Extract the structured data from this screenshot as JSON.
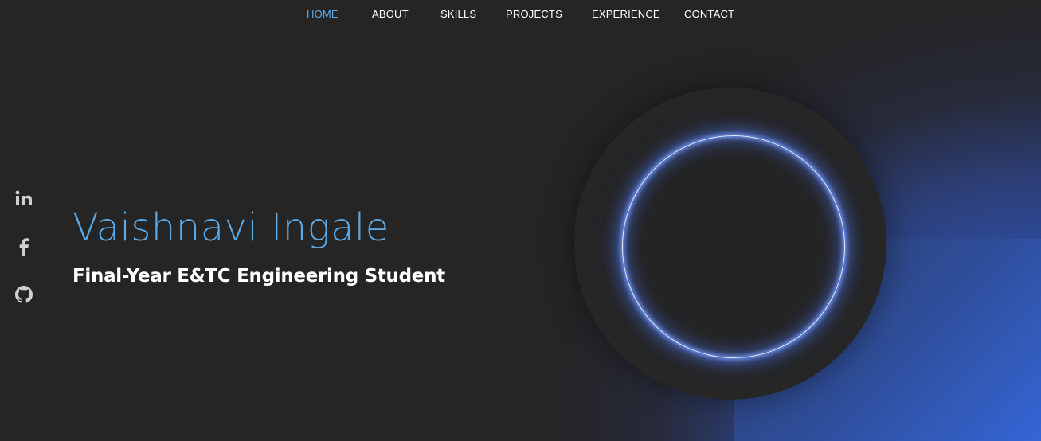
{
  "nav": {
    "items": [
      {
        "label": "HOME",
        "active": true
      },
      {
        "label": "ABOUT",
        "active": false
      },
      {
        "label": "SKILLS",
        "active": false
      },
      {
        "label": "PROJECTS",
        "active": false
      },
      {
        "label": "EXPERIENCE",
        "active": false
      },
      {
        "label": "CONTACT",
        "active": false
      }
    ]
  },
  "social": [
    {
      "icon": "linkedin-icon"
    },
    {
      "icon": "facebook-icon"
    },
    {
      "icon": "github-icon"
    }
  ],
  "hero": {
    "name": "Vaishnavi Ingale",
    "subtitle": "Final-Year E&TC Engineering Student"
  },
  "colors": {
    "background": "#252525",
    "accent": "#5aa9e6",
    "text": "#ffffff",
    "gradient_blue": "#3466d6",
    "ring_glow": "#7aa0ff"
  }
}
